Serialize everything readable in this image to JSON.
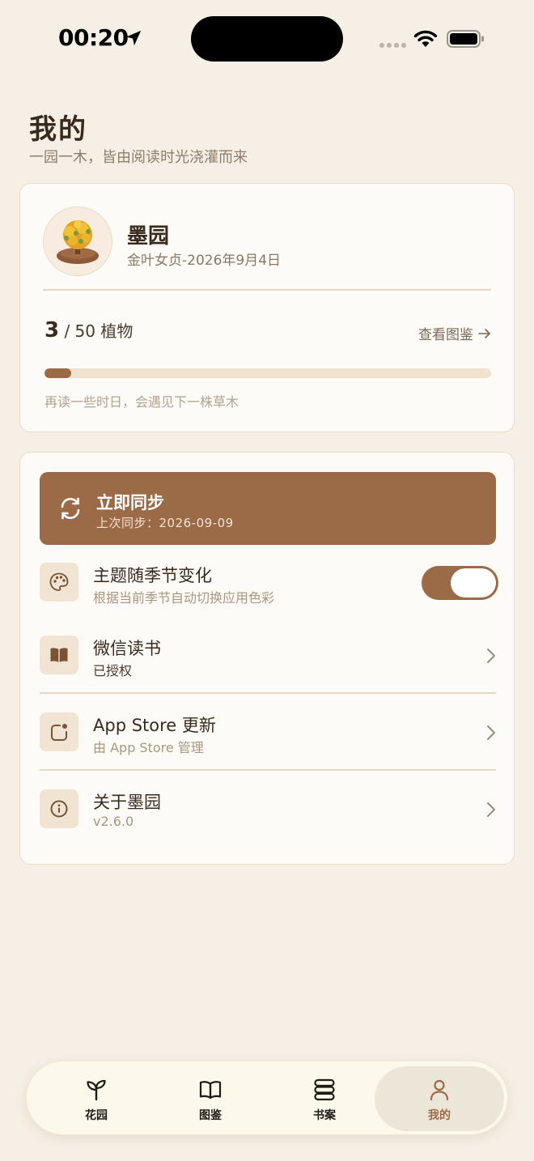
{
  "status_bar": {
    "time": "00:20"
  },
  "header": {
    "title": "我的",
    "subtitle": "一园一木，皆由阅读时光浇灌而来"
  },
  "profile": {
    "name": "墨园",
    "date": "金叶女贞-2026年9月4日",
    "plant_count": "3",
    "plant_total": " / 50 植物",
    "view_gallery": "查看图鉴",
    "progress_fraction": 0.06,
    "progress_hint": "再读一些时日，会遇见下一株草木"
  },
  "sync": {
    "title": "立即同步",
    "last_sync": "上次同步：2026-09-09"
  },
  "settings": {
    "theme": {
      "title": "主题随季节变化",
      "subtitle": "根据当前季节自动切换应用色彩",
      "enabled": true
    },
    "wechat": {
      "title": "微信读书",
      "subtitle": "已授权"
    },
    "appstore": {
      "title": "App Store 更新",
      "subtitle": "由 App Store 管理"
    },
    "about": {
      "title": "关于墨园",
      "subtitle": "v2.6.0"
    }
  },
  "tabs": [
    {
      "label": "花园",
      "icon": "sprout-icon"
    },
    {
      "label": "图鉴",
      "icon": "book-open-icon"
    },
    {
      "label": "书案",
      "icon": "stack-icon"
    },
    {
      "label": "我的",
      "icon": "person-icon",
      "active": true
    }
  ],
  "colors": {
    "accent": "#9b6a46",
    "background": "#f6efe5",
    "card": "#fdfbf7"
  }
}
